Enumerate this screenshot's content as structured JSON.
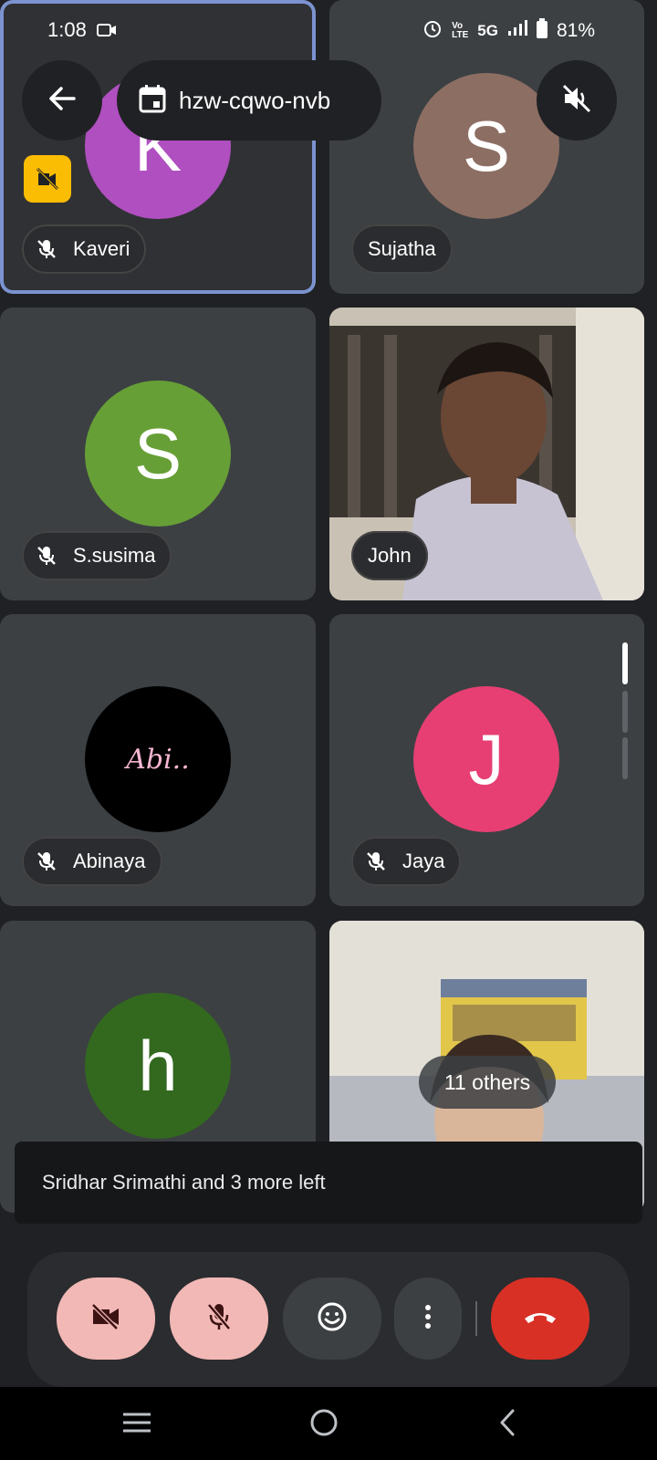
{
  "status_bar": {
    "time": "1:08",
    "network": "5G",
    "battery": "81%"
  },
  "meeting": {
    "code": "hzw-cqwo-nvb"
  },
  "participants": [
    {
      "name": "Kaveri",
      "initial": "K",
      "color": "#b04fc0",
      "muted": true
    },
    {
      "name": "Sujatha",
      "initial": "S",
      "color": "#8d6e63",
      "muted": false
    },
    {
      "name": "S.susima",
      "initial": "S",
      "color": "#679f37",
      "muted": true
    },
    {
      "name": "John",
      "muted": false,
      "video": true
    },
    {
      "name": "Abinaya",
      "avatar_text": "Abi..",
      "color": "#000000",
      "muted": true
    },
    {
      "name": "Jaya",
      "initial": "J",
      "color": "#e73f73",
      "muted": true
    },
    {
      "name": "",
      "initial": "h",
      "color": "#33691e"
    },
    {
      "label": "11 others",
      "video": true
    }
  ],
  "toast": {
    "message": "Sridhar Srimathi and 3 more left"
  },
  "controls": {
    "camera_color": "#f2b8b5",
    "mic_color": "#f2b8b5",
    "end_call_color": "#d93025"
  },
  "icons": [
    "back-arrow-icon",
    "calendar-icon",
    "speaker-off-icon",
    "no-video-icon",
    "mic-off-icon",
    "emoji-icon",
    "more-vert-icon",
    "end-call-icon"
  ]
}
